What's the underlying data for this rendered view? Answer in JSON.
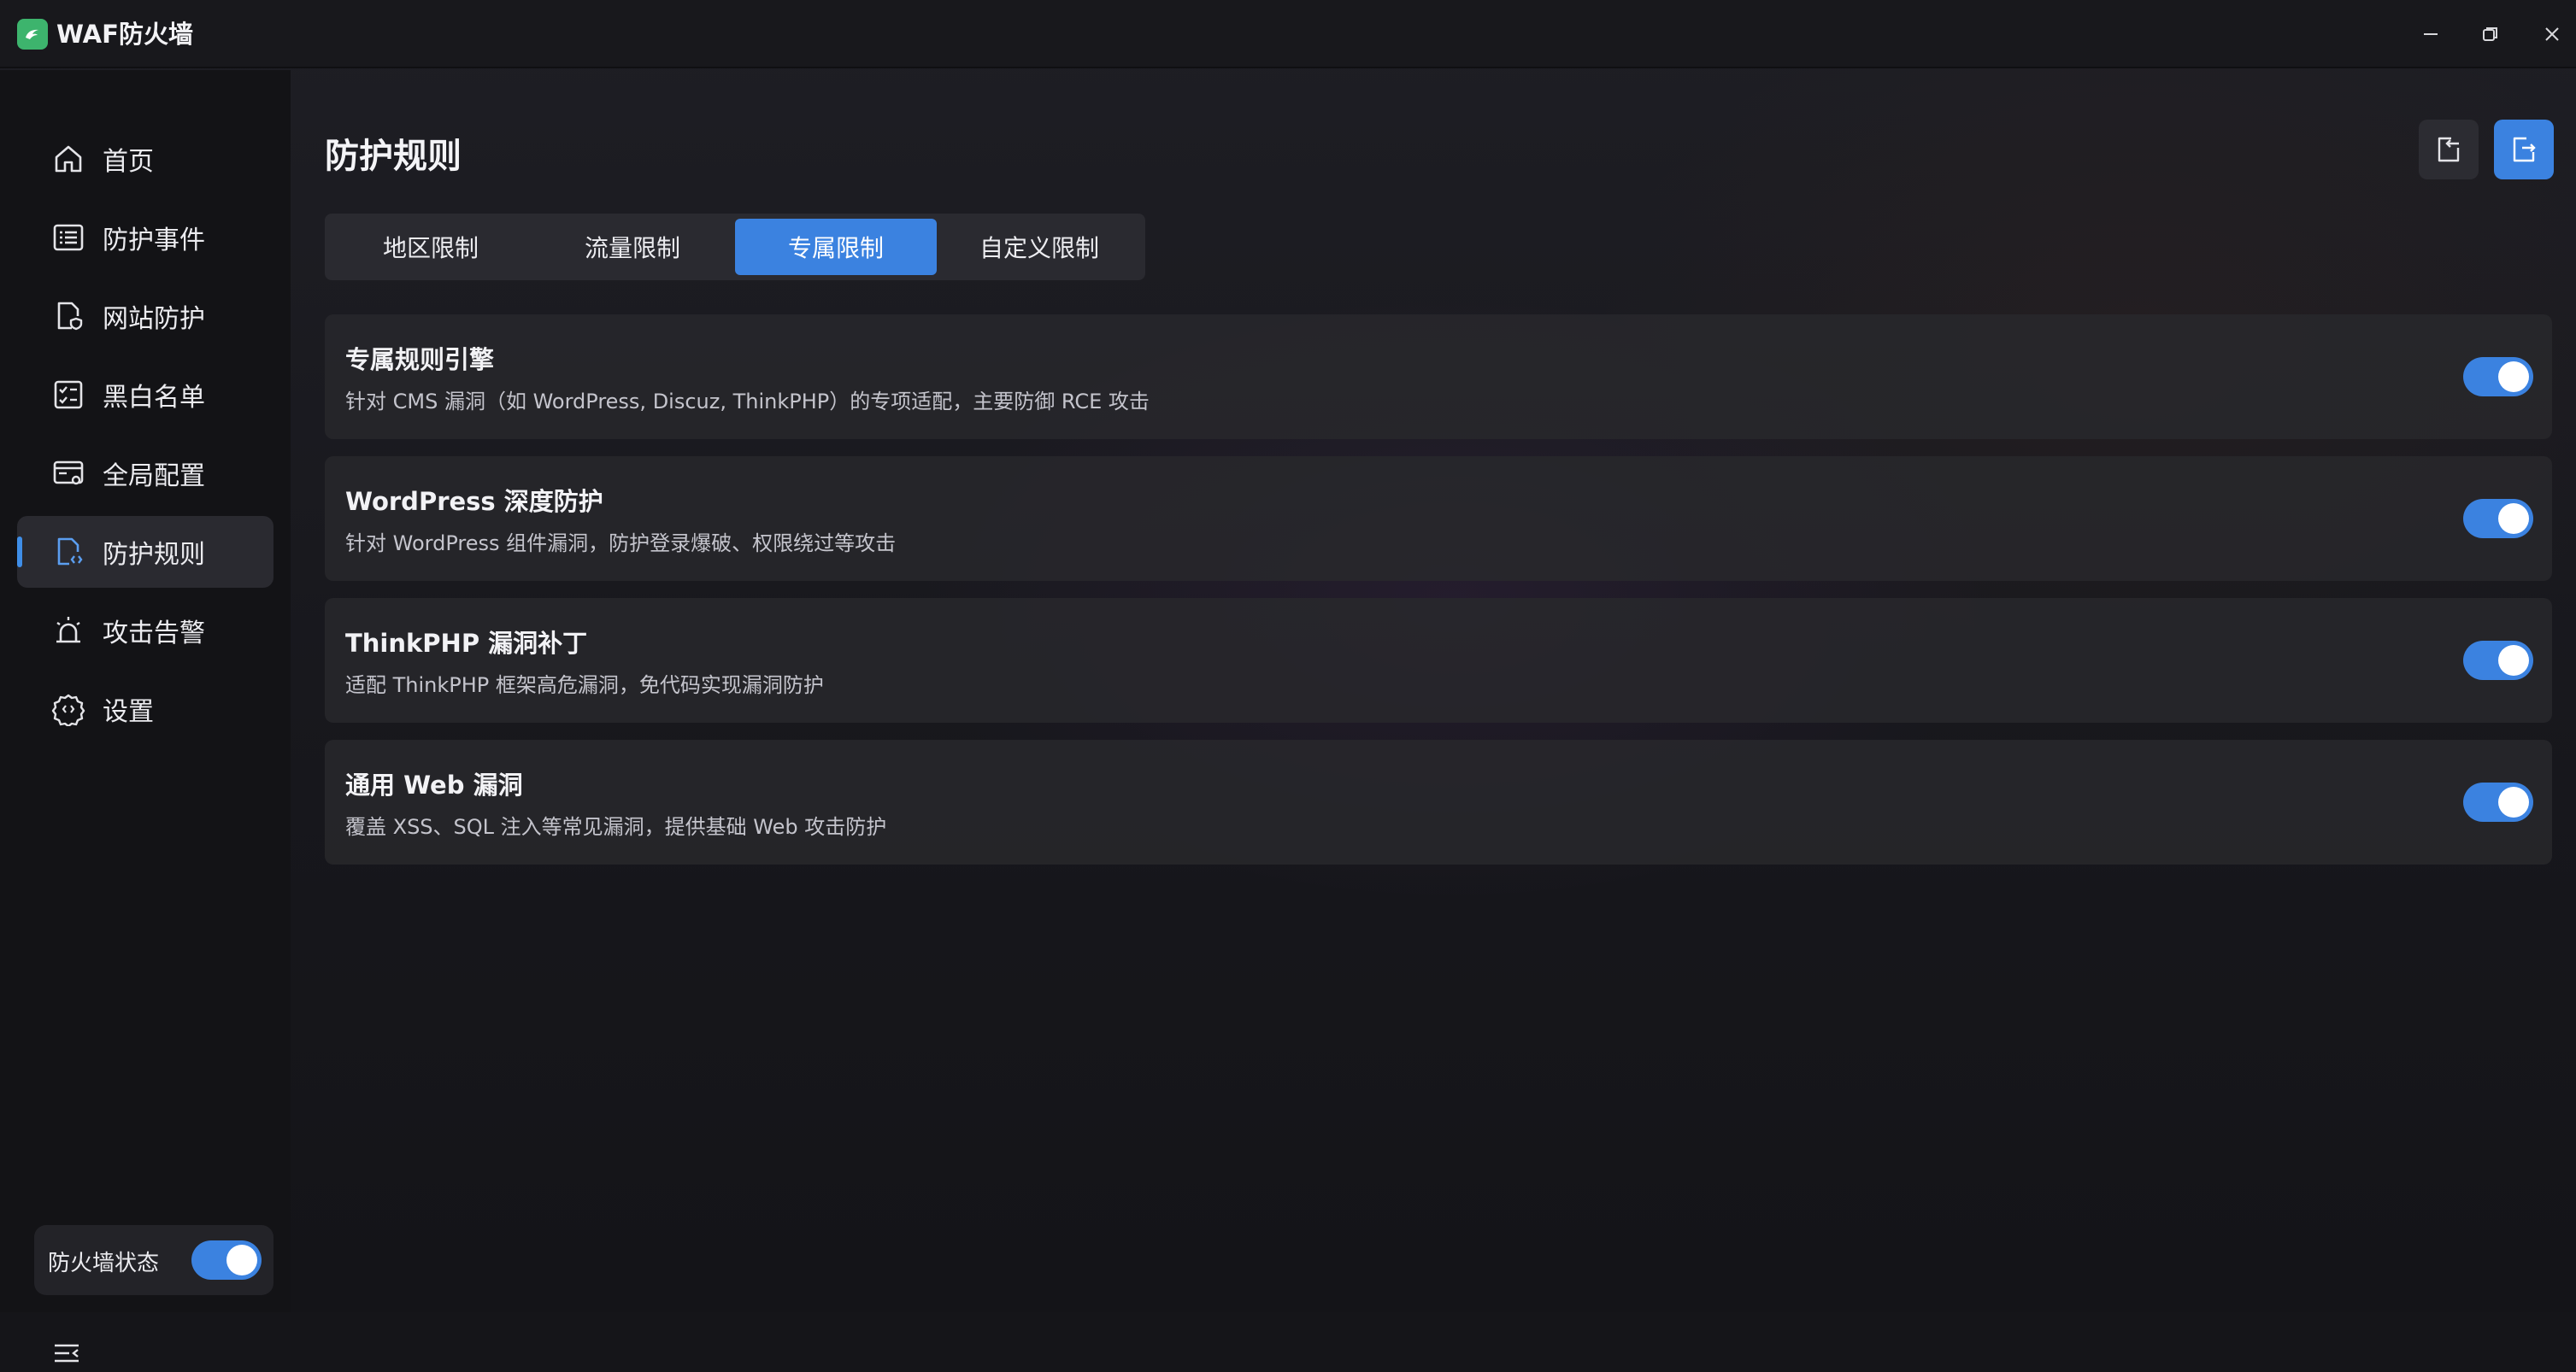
{
  "window": {
    "title": "WAF防火墙",
    "controls": {
      "minimize_icon": "minimize-icon",
      "restore_icon": "restore-icon",
      "close_icon": "close-icon"
    }
  },
  "sidebar": {
    "items": [
      {
        "label": "首页",
        "icon": "home-icon"
      },
      {
        "label": "防护事件",
        "icon": "list-icon"
      },
      {
        "label": "网站防护",
        "icon": "shield-file-icon"
      },
      {
        "label": "黑白名单",
        "icon": "checklist-icon"
      },
      {
        "label": "全局配置",
        "icon": "config-icon"
      },
      {
        "label": "防护规则",
        "icon": "code-file-icon",
        "active": true
      },
      {
        "label": "攻击告警",
        "icon": "alarm-icon"
      },
      {
        "label": "设置",
        "icon": "gear-icon"
      }
    ],
    "firewall_status": {
      "label": "防火墙状态",
      "enabled": true
    }
  },
  "main": {
    "title": "防护规则",
    "actions": {
      "import_icon": "import-icon",
      "export_icon": "export-icon"
    },
    "tabs": [
      {
        "label": "地区限制"
      },
      {
        "label": "流量限制"
      },
      {
        "label": "专属限制",
        "active": true
      },
      {
        "label": "自定义限制"
      }
    ],
    "rules": [
      {
        "title": "专属规则引擎",
        "desc": "针对 CMS 漏洞（如 WordPress, Discuz, ThinkPHP）的专项适配，主要防御 RCE 攻击",
        "enabled": true
      },
      {
        "title": "WordPress 深度防护",
        "desc": "针对 WordPress 组件漏洞，防护登录爆破、权限绕过等攻击",
        "enabled": true
      },
      {
        "title": "ThinkPHP 漏洞补丁",
        "desc": "适配 ThinkPHP 框架高危漏洞，免代码实现漏洞防护",
        "enabled": true
      },
      {
        "title": "通用 Web 漏洞",
        "desc": "覆盖 XSS、SQL 注入等常见漏洞，提供基础 Web 攻击防护",
        "enabled": true
      }
    ]
  },
  "colors": {
    "accent": "#3b82e0",
    "logo": "#3db46d"
  }
}
